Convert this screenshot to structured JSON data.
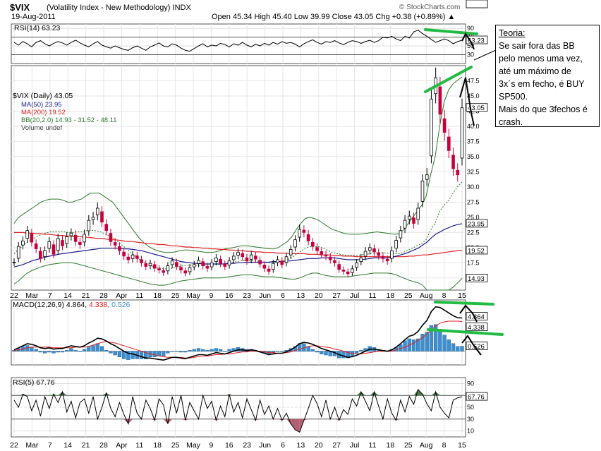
{
  "header": {
    "symbol": "$VIX",
    "name": "(Volatility Index - New Methodology)",
    "exchange": "INDX",
    "date": "19-Aug-2011",
    "ohlc": "Open 45.34  High 45.40  Low 39.99  Close 43.05  Chg +0.38 (+0.89%) ▲",
    "source": "© StockCharts.com"
  },
  "note": {
    "title": "Teoria:",
    "lines": [
      "Se sair fora das BB",
      "pelo menos uma vez,",
      "até um máximo de",
      "3x´s em fecho, é BUY",
      "SP500.",
      " Mais do que 3fechos é",
      "crash."
    ]
  },
  "legends": {
    "rsi14": "RSI(14) 63.23",
    "price": "$VIX (Daily) 43.05",
    "ma50": "MA(50) 23.95",
    "ma200": "MA(200) 19.52",
    "bb": "BB(20,2.0) 14.93 - 31.52 - 48.11",
    "volume": "Volume undef",
    "macd_prefix": "MACD(12,26,9)",
    "macd_val": "4.864,",
    "macd_sig": "4.338,",
    "macd_hist": "0.526",
    "rsi5": "RSI(5) 67.76"
  },
  "colors": {
    "up": "#000000",
    "down": "#c8003c",
    "ma50": "#1a1a8c",
    "ma200": "#e02020",
    "bb": "#2a7a2a",
    "rsi_fill": "#4a7a4a",
    "macd_hist": "#3d8fd0",
    "annotation_green": "#22bb44"
  },
  "chart_data": [
    {
      "type": "line",
      "panel": "RSI(14)",
      "y_ticks": [
        30,
        50,
        70,
        90
      ],
      "ylim": [
        10,
        100
      ],
      "value_labels": [
        "63.23"
      ],
      "values": [
        58,
        52,
        60,
        55,
        48,
        58,
        62,
        55,
        50,
        56,
        60,
        57,
        52,
        58,
        63,
        57,
        52,
        48,
        55,
        60,
        52,
        48,
        45,
        50,
        46,
        42,
        40,
        46,
        50,
        45,
        40,
        48,
        52,
        57,
        50,
        48,
        55,
        52,
        45,
        40,
        38,
        44,
        50,
        55,
        48,
        52,
        50,
        56,
        53,
        48,
        55,
        52,
        58,
        52,
        48,
        54,
        50,
        56,
        52,
        58,
        54,
        60,
        56,
        58,
        54,
        48,
        55,
        60,
        64,
        58,
        54,
        60,
        58,
        62,
        57,
        53,
        58,
        62,
        60,
        56,
        60,
        63,
        58,
        62,
        70,
        68,
        72,
        66,
        62,
        72,
        68,
        82,
        86,
        78,
        72,
        65,
        58,
        62,
        66,
        62,
        55,
        60,
        63
      ]
    },
    {
      "type": "candlestick",
      "panel": "$VIX (Daily)",
      "x_tick_labels": [
        "22",
        "Mar",
        "7",
        "14",
        "21",
        "28",
        "Apr",
        "11",
        "18",
        "25",
        "May",
        "9",
        "16",
        "23",
        "Jun",
        "6",
        "13",
        "20",
        "27",
        "Jul",
        "11",
        "18",
        "25",
        "Aug",
        "8",
        "15"
      ],
      "y_ticks": [
        15.0,
        17.5,
        20.0,
        22.5,
        25.0,
        27.5,
        30.0,
        32.5,
        35.0,
        37.5,
        40.0,
        42.5,
        45.0,
        47.5
      ],
      "ylim": [
        13,
        50
      ],
      "value_labels": [
        "48.11",
        "43.05",
        "31.52",
        "23.95",
        "19.52",
        "14.93"
      ],
      "close": [
        17.6,
        20.2,
        21.1,
        22.8,
        20.9,
        19.8,
        18.2,
        19.5,
        21.0,
        18.9,
        21.5,
        20.3,
        21.8,
        22.4,
        21.0,
        20.5,
        22.2,
        24.5,
        25.0,
        26.5,
        24.2,
        22.8,
        21.0,
        20.4,
        19.5,
        18.6,
        18.0,
        18.8,
        18.2,
        17.5,
        16.9,
        17.4,
        16.6,
        16.3,
        15.9,
        17.0,
        17.8,
        16.9,
        16.3,
        15.8,
        16.7,
        17.2,
        17.9,
        17.0,
        16.6,
        17.5,
        18.3,
        17.4,
        16.9,
        17.8,
        18.6,
        19.2,
        18.5,
        17.8,
        18.8,
        18.1,
        17.3,
        16.6,
        16.1,
        17.4,
        18.0,
        17.2,
        18.5,
        19.7,
        21.3,
        23.0,
        22.5,
        21.1,
        20.2,
        19.5,
        18.9,
        18.6,
        18.0,
        17.5,
        16.4,
        16.1,
        15.7,
        16.5,
        17.5,
        18.3,
        19.4,
        20.0,
        19.3,
        18.7,
        18.2,
        17.8,
        19.5,
        21.2,
        22.8,
        24.5,
        25.2,
        24.0,
        26.5,
        31.0,
        32.0,
        44.5,
        48.0,
        42.0,
        39.0,
        36.0,
        33.0,
        32.0,
        43.05
      ],
      "ma50": [
        16.8,
        17.0,
        17.2,
        17.5,
        17.8,
        18.0,
        18.2,
        18.4,
        18.6,
        18.7,
        18.9,
        19.0,
        19.1,
        19.2,
        19.3,
        19.4,
        19.5,
        19.6,
        19.7,
        19.8,
        19.9,
        19.9,
        19.9,
        19.9,
        19.9,
        19.8,
        19.8,
        19.7,
        19.6,
        19.5,
        19.3,
        19.1,
        18.9,
        18.7,
        18.5,
        18.3,
        18.1,
        17.9,
        17.7,
        17.6,
        17.5,
        17.4,
        17.4,
        17.3,
        17.3,
        17.3,
        17.3,
        17.3,
        17.3,
        17.4,
        17.4,
        17.5,
        17.5,
        17.6,
        17.6,
        17.6,
        17.6,
        17.6,
        17.6,
        17.7,
        17.7,
        17.7,
        17.8,
        17.8,
        17.9,
        18.0,
        18.1,
        18.2,
        18.2,
        18.2,
        18.3,
        18.3,
        18.3,
        18.3,
        18.2,
        18.1,
        18.0,
        18.0,
        18.0,
        18.0,
        18.1,
        18.2,
        18.3,
        18.3,
        18.3,
        18.3,
        18.4,
        18.6,
        18.8,
        19.0,
        19.3,
        19.6,
        19.9,
        20.4,
        20.9,
        21.6,
        22.2,
        22.6,
        23.0,
        23.3,
        23.6,
        23.8,
        23.95
      ],
      "ma200": [
        22.5,
        22.5,
        22.5,
        22.4,
        22.4,
        22.3,
        22.3,
        22.2,
        22.2,
        22.1,
        22.0,
        22.0,
        21.9,
        21.9,
        21.8,
        21.8,
        21.7,
        21.7,
        21.6,
        21.5,
        21.5,
        21.4,
        21.3,
        21.3,
        21.2,
        21.1,
        21.0,
        21.0,
        20.9,
        20.8,
        20.7,
        20.7,
        20.6,
        20.5,
        20.5,
        20.4,
        20.3,
        20.3,
        20.2,
        20.1,
        20.1,
        20.0,
        20.0,
        19.9,
        19.9,
        19.8,
        19.8,
        19.7,
        19.7,
        19.6,
        19.6,
        19.5,
        19.5,
        19.4,
        19.4,
        19.3,
        19.3,
        19.2,
        19.2,
        19.2,
        19.1,
        19.1,
        19.1,
        19.0,
        19.0,
        19.0,
        19.0,
        18.9,
        18.9,
        18.9,
        18.8,
        18.8,
        18.8,
        18.7,
        18.7,
        18.6,
        18.6,
        18.6,
        18.5,
        18.5,
        18.5,
        18.5,
        18.5,
        18.5,
        18.5,
        18.5,
        18.5,
        18.5,
        18.5,
        18.5,
        18.6,
        18.6,
        18.7,
        18.8,
        18.8,
        18.9,
        19.0,
        19.1,
        19.2,
        19.3,
        19.4,
        19.5,
        19.52
      ],
      "bb_upper": [
        24.0,
        25.0,
        25.5,
        26.0,
        26.5,
        27.0,
        27.5,
        27.8,
        28.0,
        28.0,
        28.0,
        27.8,
        27.5,
        27.5,
        27.8,
        28.0,
        28.5,
        29.0,
        29.0,
        29.0,
        28.5,
        28.0,
        27.5,
        26.5,
        25.5,
        24.5,
        23.5,
        22.5,
        21.5,
        20.8,
        20.2,
        19.8,
        19.5,
        19.3,
        19.2,
        19.2,
        19.3,
        19.5,
        19.6,
        19.6,
        19.5,
        19.4,
        19.3,
        19.2,
        19.2,
        19.3,
        19.5,
        19.8,
        19.9,
        20.0,
        20.2,
        20.3,
        20.3,
        20.2,
        20.1,
        20.0,
        19.9,
        19.8,
        19.8,
        20.0,
        20.5,
        21.0,
        21.8,
        23.0,
        24.0,
        24.8,
        25.0,
        24.8,
        24.5,
        24.0,
        23.5,
        23.0,
        22.8,
        22.5,
        22.3,
        22.2,
        22.2,
        22.2,
        22.3,
        22.4,
        22.5,
        22.6,
        22.5,
        22.4,
        22.3,
        22.2,
        22.3,
        23.0,
        24.0,
        25.0,
        26.0,
        27.0,
        28.5,
        32.0,
        35.0,
        40.0,
        44.0,
        46.0,
        47.0,
        47.6,
        48.11
      ],
      "bb_lower": [
        14.0,
        14.5,
        15.2,
        15.8,
        16.2,
        16.5,
        16.8,
        17.0,
        17.2,
        17.3,
        17.4,
        17.5,
        17.5,
        17.5,
        17.4,
        17.2,
        17.0,
        16.8,
        16.6,
        16.4,
        16.2,
        16.0,
        15.8,
        15.6,
        15.4,
        15.2,
        15.0,
        14.8,
        14.6,
        14.4,
        14.2,
        14.0,
        13.9,
        13.8,
        13.8,
        13.9,
        14.1,
        14.3,
        14.5,
        14.6,
        14.7,
        14.8,
        14.9,
        15.0,
        15.0,
        15.0,
        15.0,
        15.0,
        15.1,
        15.2,
        15.3,
        15.4,
        15.5,
        15.5,
        15.5,
        15.4,
        15.3,
        15.2,
        15.2,
        15.2,
        15.1,
        15.0,
        14.9,
        14.8,
        14.8,
        15.0,
        15.3,
        15.6,
        15.8,
        15.8,
        15.6,
        15.4,
        15.3,
        15.2,
        15.2,
        15.2,
        15.2,
        15.3,
        15.4,
        15.5,
        15.6,
        15.7,
        15.8,
        15.8,
        15.8,
        15.8,
        15.7,
        15.5,
        15.2,
        14.9,
        14.6,
        14.4,
        14.2,
        13.8,
        13.0,
        12.0,
        10.0,
        9.5,
        11.0,
        12.5,
        13.5,
        14.2,
        14.93
      ]
    },
    {
      "type": "line",
      "panel": "MACD(12,26,9)",
      "value_labels": [
        "4.864",
        "4.338",
        "0.526"
      ],
      "macd": [
        0.2,
        0.5,
        0.8,
        1.1,
        1.0,
        0.8,
        0.5,
        0.4,
        0.5,
        0.3,
        0.4,
        0.4,
        0.6,
        0.8,
        0.7,
        0.6,
        0.8,
        1.2,
        1.5,
        1.9,
        1.8,
        1.5,
        1.1,
        0.8,
        0.4,
        0.0,
        -0.3,
        -0.4,
        -0.6,
        -0.8,
        -1.0,
        -1.0,
        -1.1,
        -1.2,
        -1.3,
        -1.1,
        -0.9,
        -0.9,
        -1.0,
        -1.1,
        -0.9,
        -0.7,
        -0.5,
        -0.5,
        -0.6,
        -0.4,
        -0.2,
        -0.3,
        -0.4,
        -0.2,
        0.0,
        0.2,
        0.2,
        0.1,
        0.2,
        0.1,
        -0.1,
        -0.3,
        -0.5,
        -0.4,
        -0.3,
        -0.3,
        -0.1,
        0.2,
        0.6,
        1.1,
        1.3,
        1.2,
        1.0,
        0.7,
        0.4,
        0.2,
        0.0,
        -0.2,
        -0.5,
        -0.7,
        -0.9,
        -0.8,
        -0.6,
        -0.3,
        0.0,
        0.3,
        0.3,
        0.2,
        0.1,
        0.0,
        0.2,
        0.6,
        1.1,
        1.7,
        2.2,
        2.4,
        2.9,
        3.8,
        4.5,
        5.8,
        6.5,
        6.4,
        6.0,
        5.6,
        5.2,
        4.9,
        4.864
      ],
      "signal": [
        0.1,
        0.2,
        0.3,
        0.5,
        0.6,
        0.6,
        0.6,
        0.6,
        0.6,
        0.5,
        0.5,
        0.5,
        0.5,
        0.5,
        0.6,
        0.6,
        0.6,
        0.7,
        0.9,
        1.1,
        1.3,
        1.4,
        1.3,
        1.2,
        1.0,
        0.8,
        0.6,
        0.4,
        0.2,
        0.0,
        -0.2,
        -0.4,
        -0.5,
        -0.7,
        -0.8,
        -0.9,
        -0.9,
        -0.9,
        -0.9,
        -1.0,
        -1.0,
        -0.9,
        -0.8,
        -0.7,
        -0.7,
        -0.6,
        -0.5,
        -0.5,
        -0.4,
        -0.4,
        -0.3,
        -0.2,
        -0.1,
        -0.1,
        0.0,
        0.0,
        0.0,
        -0.1,
        -0.2,
        -0.2,
        -0.3,
        -0.3,
        -0.2,
        -0.1,
        0.1,
        0.3,
        0.5,
        0.7,
        0.8,
        0.8,
        0.7,
        0.6,
        0.5,
        0.3,
        0.2,
        0.0,
        -0.2,
        -0.3,
        -0.4,
        -0.4,
        -0.3,
        -0.2,
        -0.1,
        0.0,
        0.0,
        0.0,
        0.0,
        0.2,
        0.4,
        0.6,
        0.9,
        1.2,
        1.6,
        2.0,
        2.5,
        3.1,
        3.7,
        4.1,
        4.3,
        4.4,
        4.4,
        4.4,
        4.338
      ]
    },
    {
      "type": "line",
      "panel": "RSI(5)",
      "y_ticks": [
        10,
        30,
        50,
        70,
        90
      ],
      "ylim": [
        0,
        100
      ],
      "value_labels": [
        "67.76"
      ],
      "values": [
        62,
        50,
        72,
        68,
        44,
        62,
        35,
        68,
        48,
        72,
        58,
        76,
        42,
        60,
        32,
        58,
        64,
        40,
        68,
        30,
        50,
        74,
        48,
        34,
        58,
        38,
        22,
        68,
        40,
        30,
        62,
        48,
        28,
        64,
        54,
        22,
        68,
        40,
        70,
        28,
        58,
        44,
        30,
        70,
        48,
        60,
        28,
        52,
        34,
        72,
        42,
        58,
        32,
        64,
        46,
        28,
        62,
        38,
        52,
        30,
        48,
        28,
        40,
        22,
        12,
        8,
        28,
        48,
        70,
        56,
        34,
        62,
        30,
        50,
        28,
        46,
        38,
        64,
        52,
        76,
        60,
        44,
        76,
        52,
        30,
        64,
        40,
        28,
        62,
        42,
        68,
        55,
        80,
        72,
        56,
        44,
        76,
        50,
        40,
        32,
        62,
        66,
        67.76
      ]
    }
  ]
}
